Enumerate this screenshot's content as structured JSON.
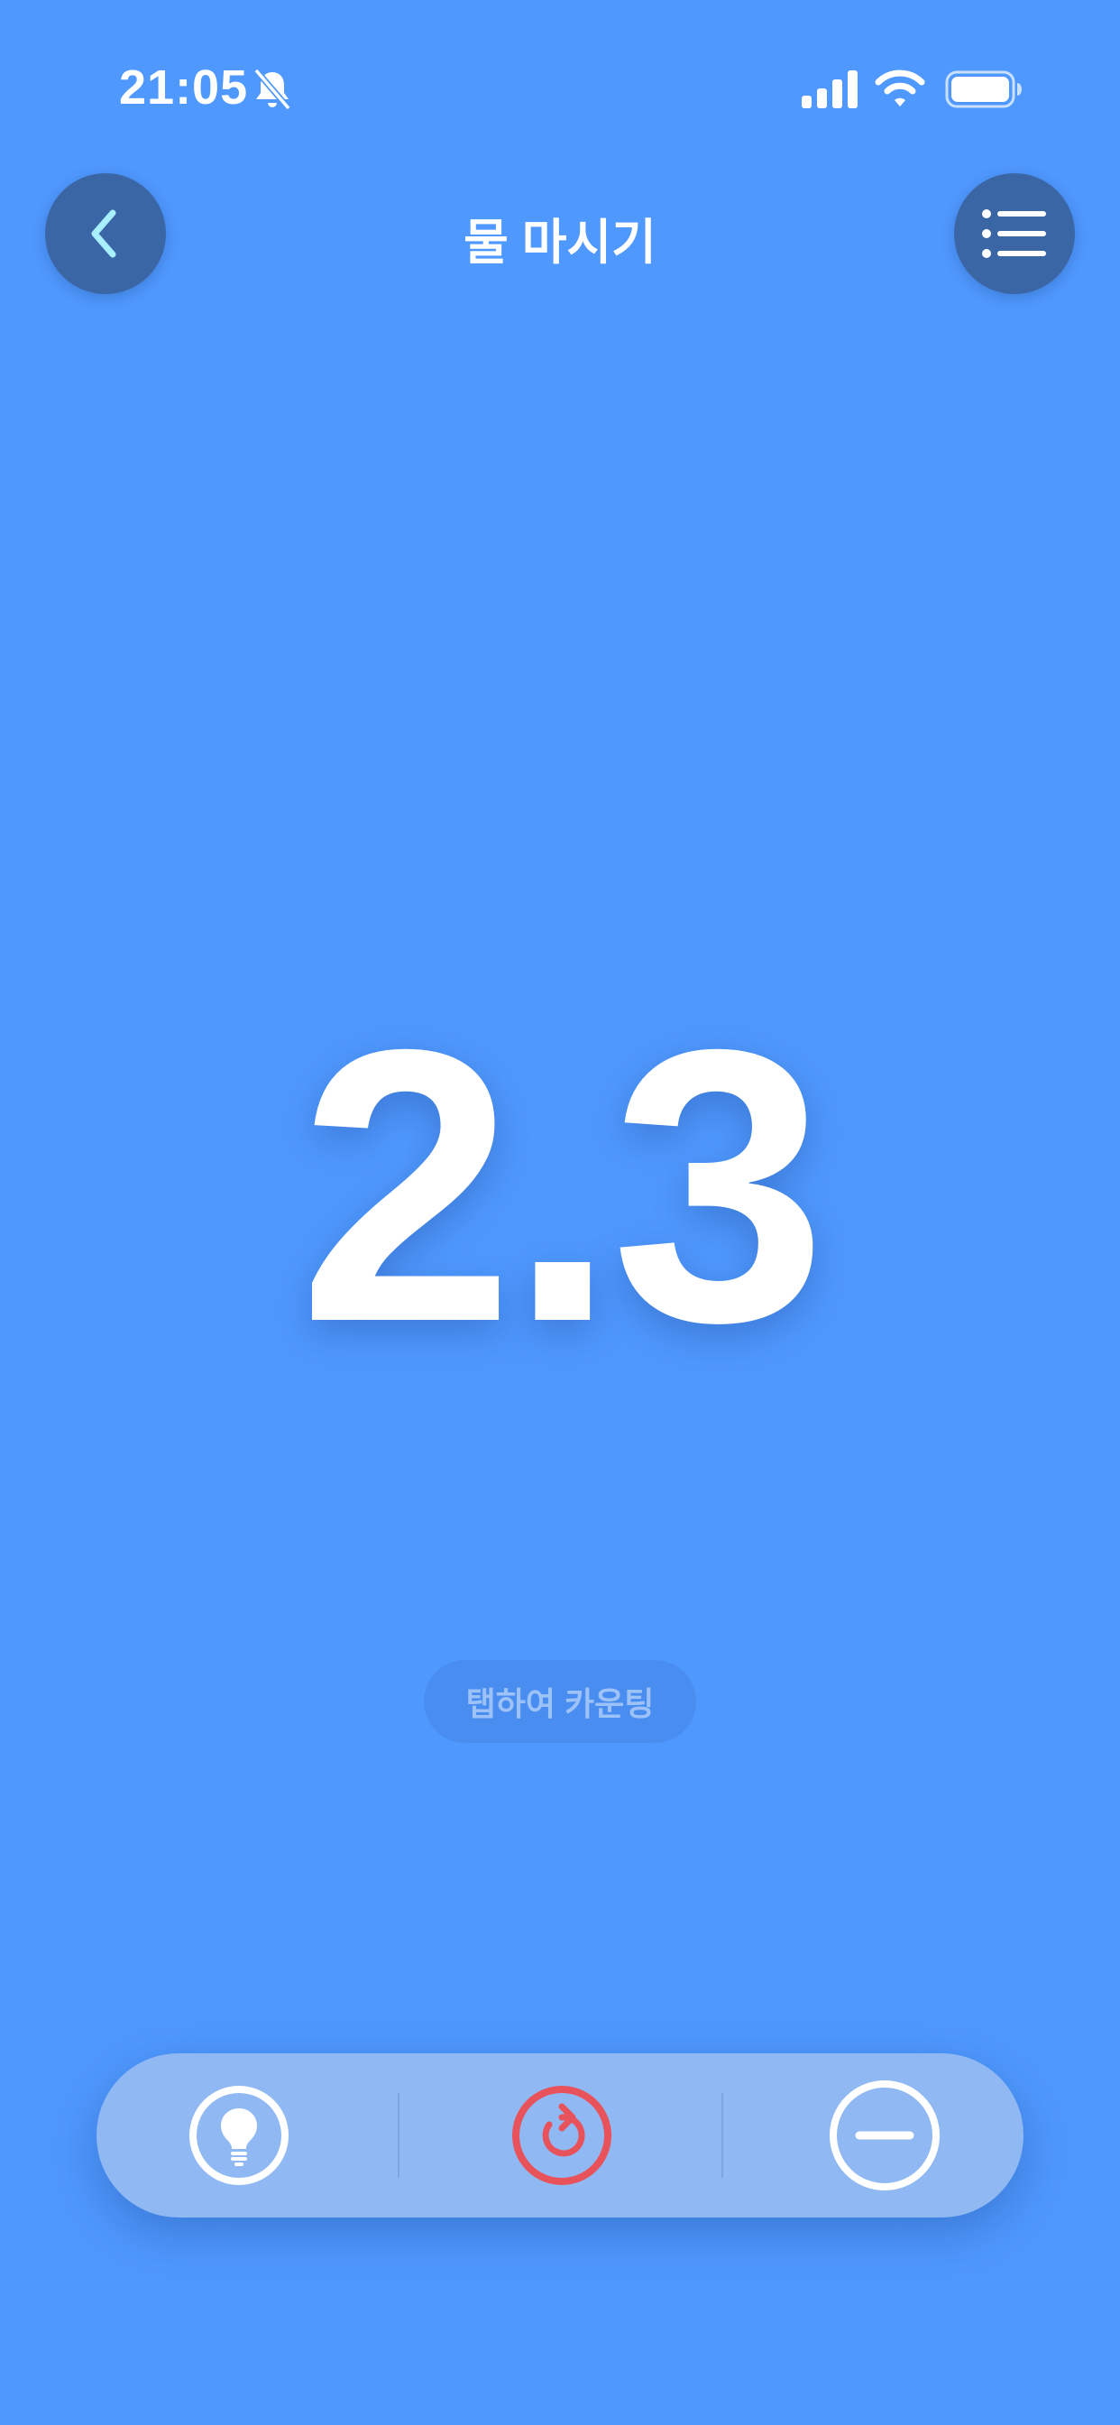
{
  "status_bar": {
    "time": "21:05",
    "icons": [
      "bell-slash-icon",
      "cellular-signal-icon",
      "wifi-icon",
      "battery-icon"
    ]
  },
  "header": {
    "title": "물 마시기",
    "back_icon": "chevron-left-icon",
    "menu_icon": "list-icon"
  },
  "counter": {
    "value": "2.3",
    "hint": "탭하여 카운팅"
  },
  "toolbar": {
    "items": [
      {
        "name": "tip",
        "icon": "lightbulb-icon",
        "color": "#ffffff"
      },
      {
        "name": "reset",
        "icon": "reset-icon",
        "color": "#e8525b"
      },
      {
        "name": "decrement",
        "icon": "minus-circle-icon",
        "color": "#ffffff"
      }
    ]
  },
  "colors": {
    "background": "#4f98fd",
    "nav_button": "#3b66a6",
    "toolbar": "#90b9f3",
    "reset_accent": "#e8525b",
    "back_chevron": "#a8f0ff"
  }
}
